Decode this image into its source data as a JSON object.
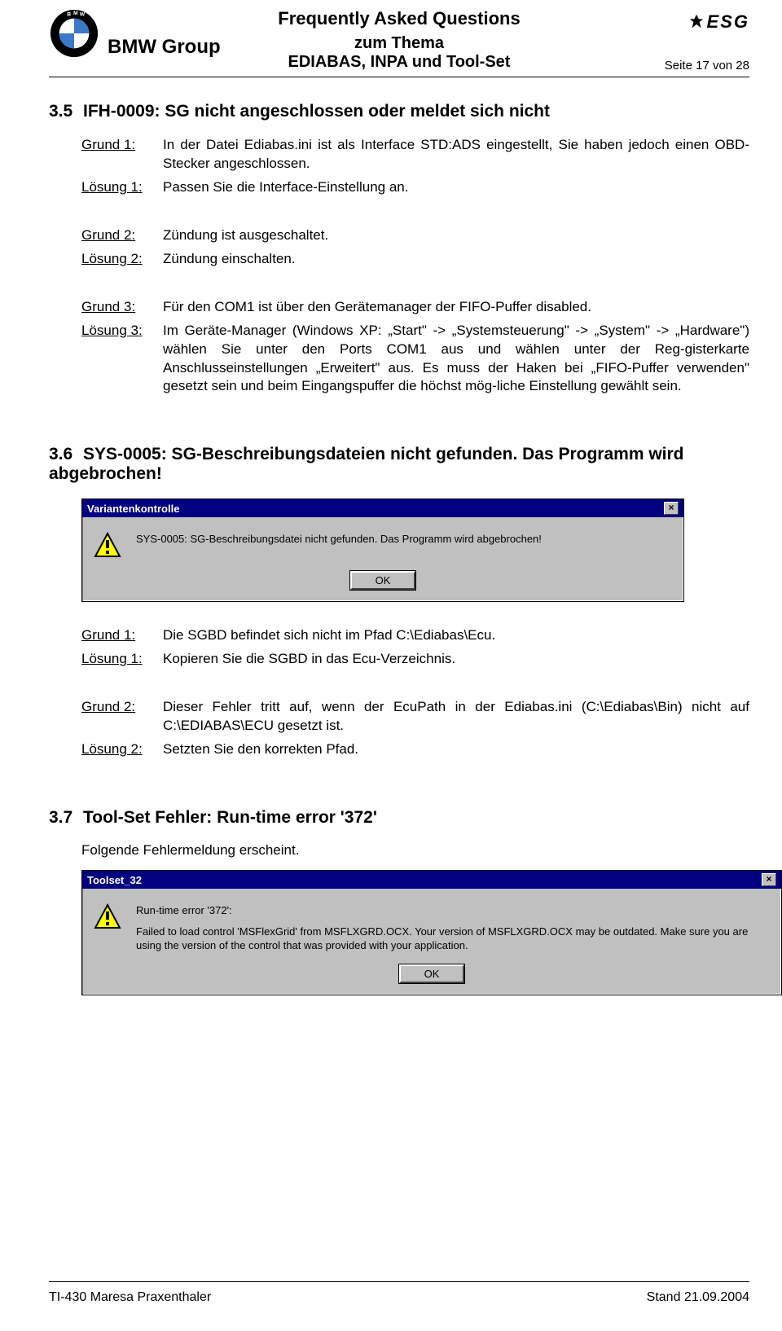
{
  "header": {
    "group": "BMW Group",
    "title1": "Frequently Asked Questions",
    "title2": "zum Thema",
    "title3": "EDIABAS, INPA und Tool-Set",
    "page": "Seite 17 von 28",
    "esg": "ESG"
  },
  "s35": {
    "num": "3.5",
    "title": "IFH-0009: SG nicht angeschlossen oder meldet sich nicht",
    "g1_label": "Grund 1:",
    "g1_text": "In der Datei Ediabas.ini ist als Interface STD:ADS eingestellt, Sie haben jedoch einen OBD-Stecker angeschlossen.",
    "l1_label": "Lösung 1:",
    "l1_text": "Passen Sie die Interface-Einstellung an.",
    "g2_label": "Grund 2:",
    "g2_text": "Zündung ist ausgeschaltet.",
    "l2_label": "Lösung 2:",
    "l2_text": "Zündung einschalten.",
    "g3_label": "Grund 3:",
    "g3_text": "Für den COM1 ist über den Gerätemanager der FIFO-Puffer disabled.",
    "l3_label": "Lösung 3:",
    "l3_text": "Im Geräte-Manager (Windows XP: „Start\" -> „Systemsteuerung\" -> „System\" -> „Hardware\") wählen Sie unter den Ports COM1 aus und wählen unter der Reg-gisterkarte Anschlusseinstellungen „Erweitert\" aus. Es muss der Haken bei „FIFO-Puffer verwenden\" gesetzt sein und beim Eingangspuffer die höchst mög-liche Einstellung gewählt sein."
  },
  "s36": {
    "num": "3.6",
    "title": "SYS-0005: SG-Beschreibungsdateien nicht gefunden. Das Programm wird abgebrochen!",
    "dlg_title": "Variantenkontrolle",
    "dlg_msg": "SYS-0005: SG-Beschreibungsdatei nicht gefunden. Das Programm wird abgebrochen!",
    "dlg_ok": "OK",
    "g1_label": "Grund 1:",
    "g1_text": "Die SGBD befindet sich nicht im Pfad C:\\Ediabas\\Ecu.",
    "l1_label": "Lösung 1:",
    "l1_text": "Kopieren Sie die SGBD in das Ecu-Verzeichnis.",
    "g2_label": "Grund 2:",
    "g2_text": "Dieser Fehler tritt auf, wenn der EcuPath in der Ediabas.ini (C:\\Ediabas\\Bin) nicht auf C:\\EDIABAS\\ECU gesetzt ist.",
    "l2_label": "Lösung 2:",
    "l2_text": "Setzten Sie den korrekten Pfad."
  },
  "s37": {
    "num": "3.7",
    "title": "Tool-Set Fehler: Run-time error '372'",
    "intro": "Folgende Fehlermeldung erscheint.",
    "dlg_title": "Toolset_32",
    "dlg_msg_line1": "Run-time error '372':",
    "dlg_msg_line2": "Failed to load control 'MSFlexGrid' from MSFLXGRD.OCX. Your version of MSFLXGRD.OCX may be outdated. Make sure you are using the version of the control that was provided with your application.",
    "dlg_ok": "OK"
  },
  "footer": {
    "left": "TI-430   Maresa Praxenthaler",
    "right": "Stand 21.09.2004"
  }
}
